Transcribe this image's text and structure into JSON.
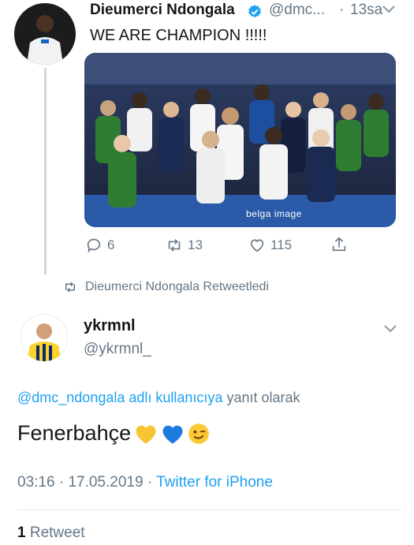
{
  "quoted_tweet": {
    "author_name": "Dieumerci Ndongala",
    "handle": "@dmc...",
    "separator": "·",
    "time": "13sa",
    "text": "WE ARE CHAMPION !!!!!",
    "media_watermark": "belga image",
    "actions": {
      "replies": "6",
      "retweets": "13",
      "likes": "115"
    }
  },
  "retweet_notice": "Dieumerci Ndongala Retweetledi",
  "main_tweet": {
    "author_name": "ykrmnl",
    "handle": "@ykrmnl_",
    "replying_to_handle": "@dmc_ndongala adlı kullanıcıya",
    "replying_suffix": "yanıt olarak",
    "text": "Fenerbahçe",
    "emojis": [
      "yellow-heart",
      "blue-heart",
      "winking-face"
    ],
    "time": "03:16",
    "sep1": "·",
    "date": "17.05.2019",
    "sep2": "·",
    "source": "Twitter for iPhone",
    "retweet_count": "1",
    "retweet_label": "Retweet"
  },
  "colors": {
    "accent": "#1da1f2",
    "muted": "#657786",
    "text": "#14171a",
    "divider": "#e1e8ed"
  }
}
